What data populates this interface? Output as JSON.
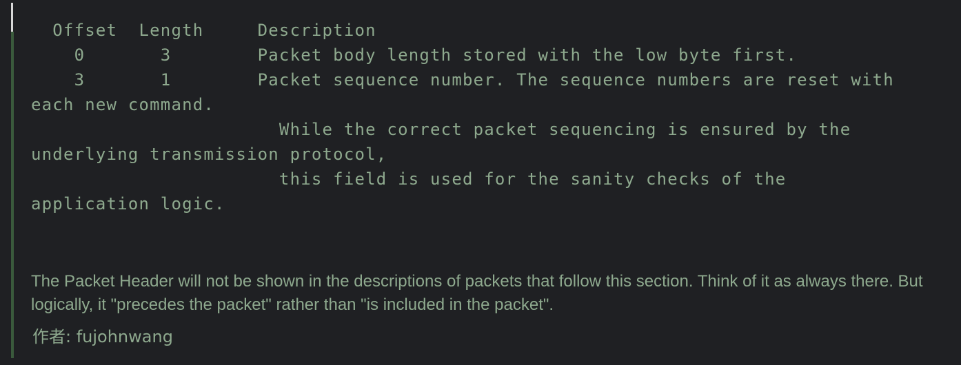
{
  "code_block": {
    "text": "  Offset  Length     Description\n    0       3        Packet body length stored with the low byte first.\n    3       1        Packet sequence number. The sequence numbers are reset with\neach new command.\n                       While the correct packet sequencing is ensured by the\nunderlying transmission protocol,\n                       this field is used for the sanity checks of the\napplication logic."
  },
  "paragraph": {
    "text": "The Packet Header will not be shown in the descriptions of packets that follow this section. Think of it as always there. But logically, it \"precedes the packet\" rather than \"is included in the packet\"."
  },
  "author": {
    "text": "作者: fujohnwang"
  },
  "colors": {
    "background": "#1f2023",
    "text": "#8ea98e",
    "quote_bar": "#3a5a3c",
    "caret": "#d8d8d8"
  }
}
